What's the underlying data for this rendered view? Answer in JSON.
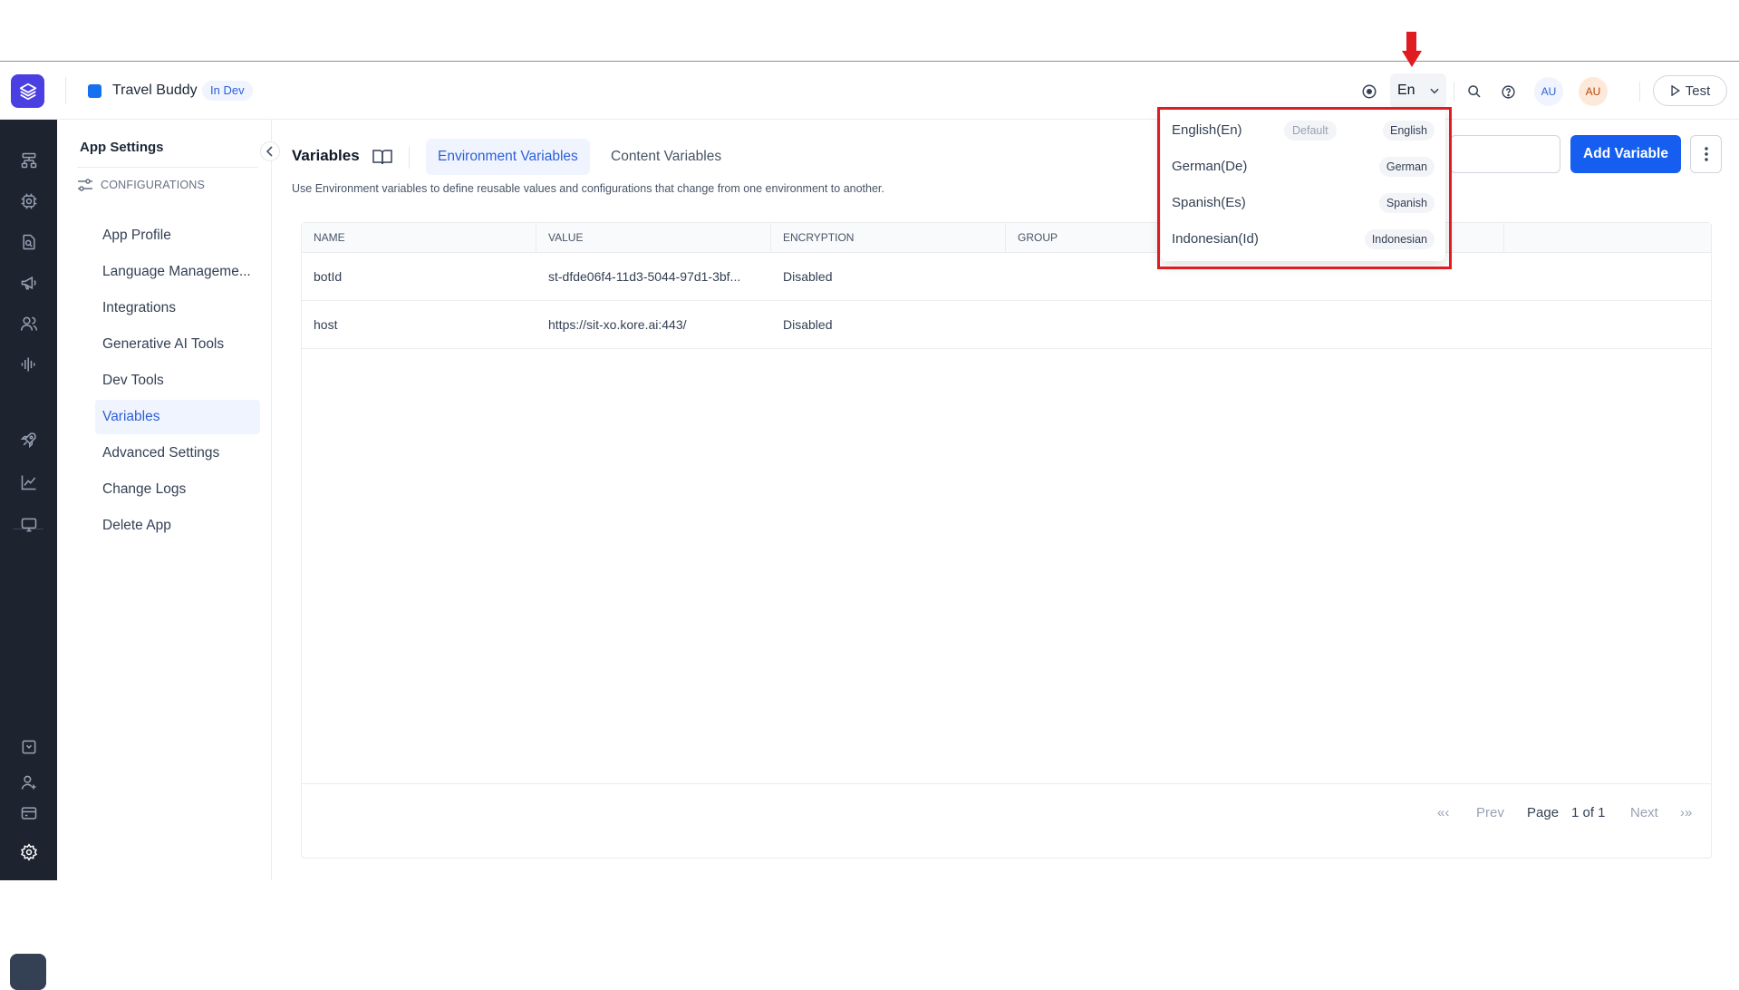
{
  "header": {
    "app_title": "Travel Buddy",
    "status_badge": "In Dev",
    "language_button": "En",
    "avatars": [
      "AU",
      "AU"
    ],
    "test_button": "Test"
  },
  "sidebar": {
    "title": "App Settings",
    "section": "CONFIGURATIONS",
    "items": [
      {
        "label": "App Profile",
        "active": false
      },
      {
        "label": "Language Manageme...",
        "active": false
      },
      {
        "label": "Integrations",
        "active": false
      },
      {
        "label": "Generative AI Tools",
        "active": false
      },
      {
        "label": "Dev Tools",
        "active": false
      },
      {
        "label": "Variables",
        "active": true
      },
      {
        "label": "Advanced Settings",
        "active": false
      },
      {
        "label": "Change Logs",
        "active": false
      },
      {
        "label": "Delete App",
        "active": false
      }
    ]
  },
  "main": {
    "page_title": "Variables",
    "tabs": [
      {
        "label": "Environment Variables",
        "active": true
      },
      {
        "label": "Content Variables",
        "active": false
      }
    ],
    "description": "Use Environment variables to define reusable values and configurations that change from one environment to another.",
    "add_button": "Add Variable"
  },
  "table": {
    "columns": [
      "NAME",
      "VALUE",
      "ENCRYPTION",
      "GROUP"
    ],
    "rows": [
      {
        "name": "botId",
        "value": "st-dfde06f4-11d3-5044-97d1-3bf...",
        "encryption": "Disabled",
        "group": ""
      },
      {
        "name": "host",
        "value": "https://sit-xo.kore.ai:443/",
        "encryption": "Disabled",
        "group": ""
      }
    ]
  },
  "pagination": {
    "first": "«‹",
    "prev": "Prev",
    "page_label": "Page",
    "page_value": "1 of 1",
    "next": "Next",
    "last": "›»"
  },
  "language_dropdown": {
    "items": [
      {
        "label": "English(En)",
        "default": "Default",
        "tag": "English"
      },
      {
        "label": "German(De)",
        "default": "",
        "tag": "German"
      },
      {
        "label": "Spanish(Es)",
        "default": "",
        "tag": "Spanish"
      },
      {
        "label": "Indonesian(Id)",
        "default": "",
        "tag": "Indonesian"
      }
    ]
  },
  "colors": {
    "accent": "#155eef",
    "active_bg": "#eff4ff",
    "rail_bg": "#1d2430",
    "annotation_red": "#e01b22"
  }
}
